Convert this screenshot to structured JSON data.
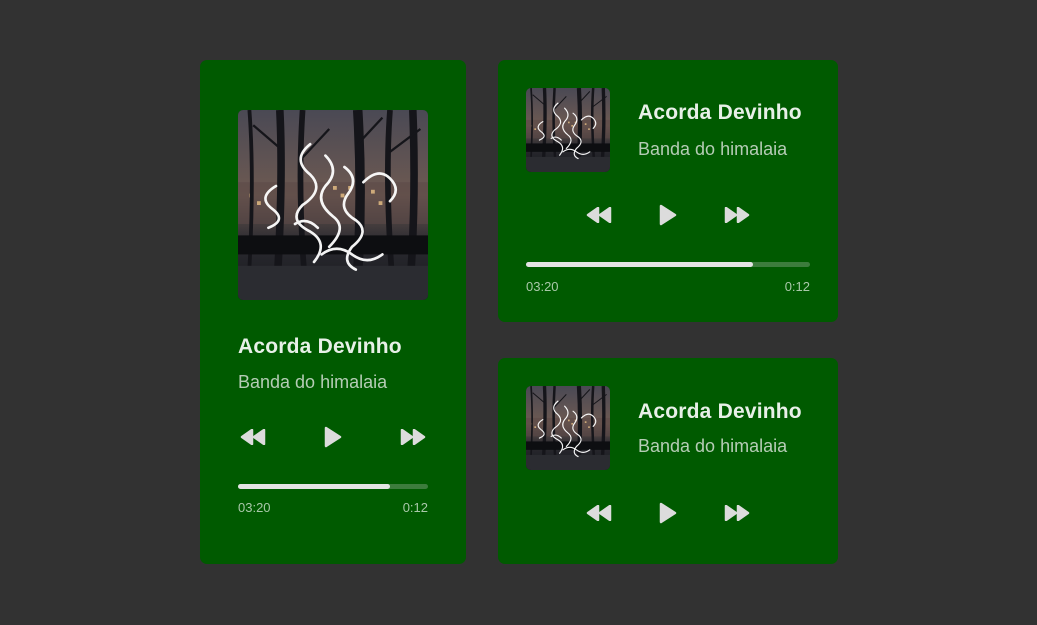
{
  "players": [
    {
      "variant": "large",
      "title": "Acorda Devinho",
      "artist": "Banda do himalaia",
      "cover_image": "long-exposure-light-painting-in-park-at-night",
      "controls": {
        "rewind_icon": "rewind-icon",
        "play_icon": "play-icon",
        "forward_icon": "fast-forward-icon"
      },
      "progress_fraction": 0.8,
      "time_elapsed": "03:20",
      "time_remaining": "0:12"
    },
    {
      "variant": "medium",
      "title": "Acorda Devinho",
      "artist": "Banda do himalaia",
      "cover_image": "long-exposure-light-painting-in-park-at-night",
      "controls": {
        "rewind_icon": "rewind-icon",
        "play_icon": "play-icon",
        "forward_icon": "fast-forward-icon"
      },
      "progress_fraction": 0.8,
      "time_elapsed": "03:20",
      "time_remaining": "0:12"
    },
    {
      "variant": "small",
      "title": "Acorda Devinho",
      "artist": "Banda do himalaia",
      "cover_image": "long-exposure-light-painting-in-park-at-night",
      "controls": {
        "rewind_icon": "rewind-icon",
        "play_icon": "play-icon",
        "forward_icon": "fast-forward-icon"
      }
    }
  ],
  "colors": {
    "page_background": "#323232",
    "card_background": "#005a00",
    "title_text": "#e8f0e8",
    "artist_text": "#b5ccb5",
    "control_icons": "#dcdcdc",
    "progress_fill": "#e4e4e4",
    "progress_track": "#3c7c3c",
    "time_text": "#a9c8a9"
  }
}
